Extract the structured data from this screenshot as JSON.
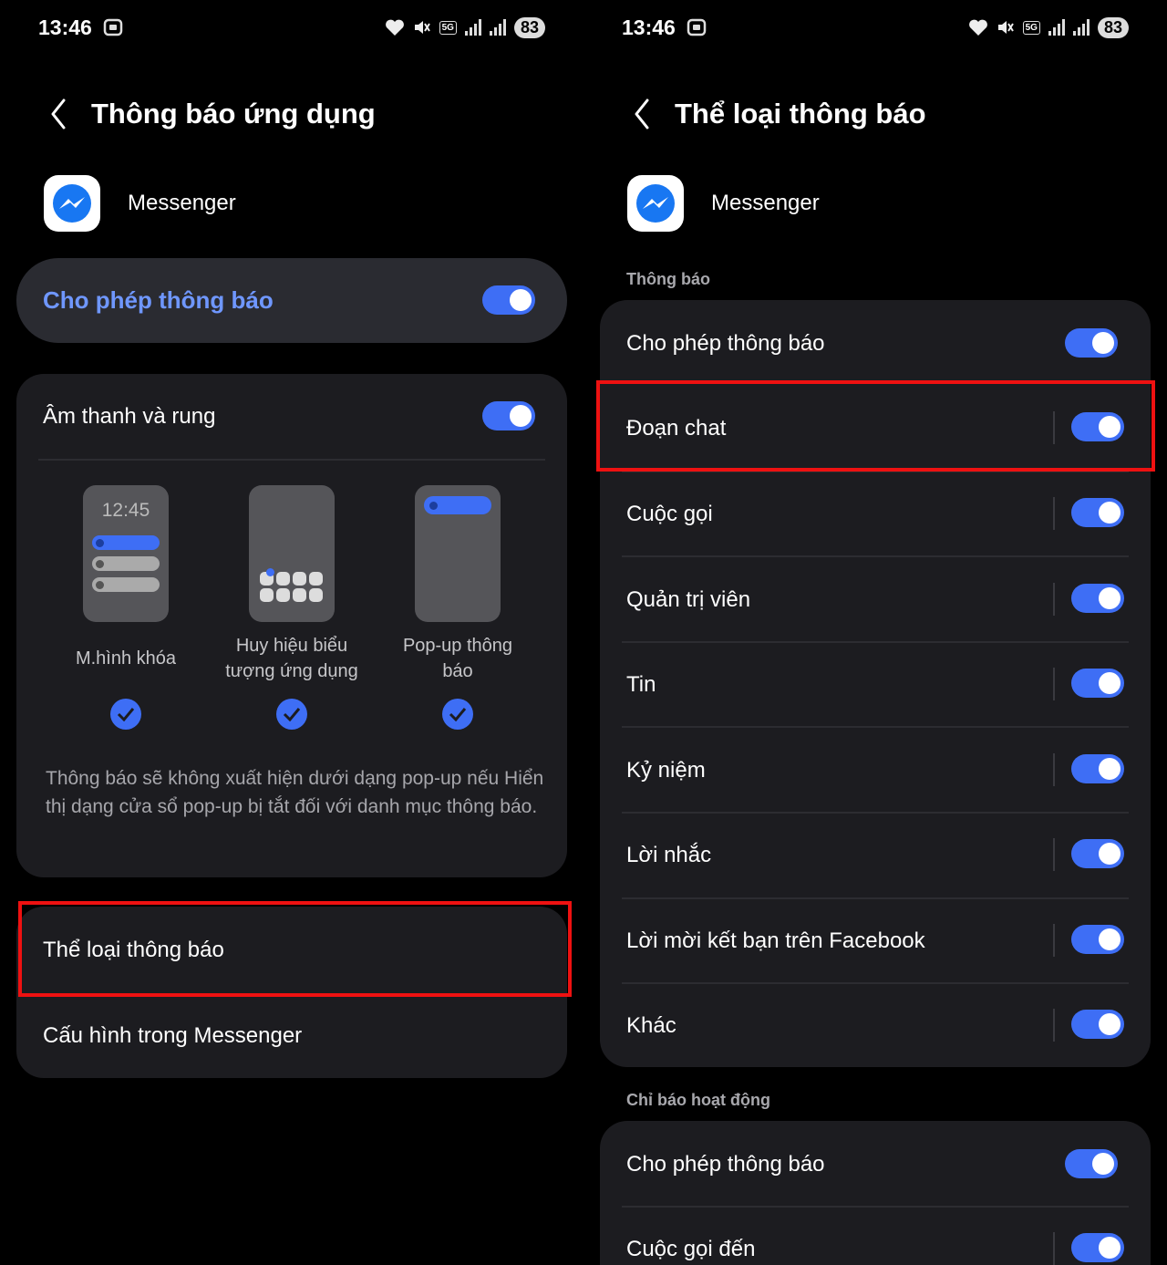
{
  "status": {
    "time": "13:46",
    "network": "5G",
    "battery": "83"
  },
  "left": {
    "title": "Thông báo ứng dụng",
    "app_name": "Messenger",
    "allow_notifications": {
      "label": "Cho phép thông báo",
      "on": true
    },
    "sound_vibration": {
      "label": "Âm thanh và rung",
      "on": true
    },
    "styles": [
      {
        "label_line1": "M.hình khóa",
        "label_line2": "",
        "preview_time": "12:45",
        "checked": true
      },
      {
        "label_line1": "Huy hiệu biểu",
        "label_line2": "tượng ứng dụng",
        "checked": true
      },
      {
        "label_line1": "Pop-up thông",
        "label_line2": "báo",
        "checked": true
      }
    ],
    "info_text": "Thông báo sẽ không xuất hiện dưới dạng pop-up nếu Hiển thị dạng cửa sổ pop-up bị tắt đối với danh mục thông báo.",
    "menu": [
      {
        "label": "Thể loại thông báo",
        "highlighted": true
      },
      {
        "label": "Cấu hình trong Messenger",
        "highlighted": false
      }
    ]
  },
  "right": {
    "title": "Thể loại thông báo",
    "app_name": "Messenger",
    "section1": "Thông báo",
    "allow_label": "Cho phép thông báo",
    "categories": [
      {
        "label": "Đoạn chat",
        "on": true,
        "highlighted": true
      },
      {
        "label": "Cuộc gọi",
        "on": true
      },
      {
        "label": "Quản trị viên",
        "on": true
      },
      {
        "label": "Tin",
        "on": true
      },
      {
        "label": "Kỷ niệm",
        "on": true
      },
      {
        "label": "Lời nhắc",
        "on": true
      },
      {
        "label": "Lời mời kết bạn trên Facebook",
        "on": true
      },
      {
        "label": "Khác",
        "on": true
      }
    ],
    "section2": "Chỉ báo hoạt động",
    "section2_rows": [
      {
        "label": "Cho phép thông báo",
        "on": true
      },
      {
        "label": "Cuộc gọi đến",
        "on": true
      }
    ]
  },
  "colors": {
    "accent": "#3e6ef5",
    "card": "#1c1c20",
    "highlight": "#e11111"
  }
}
